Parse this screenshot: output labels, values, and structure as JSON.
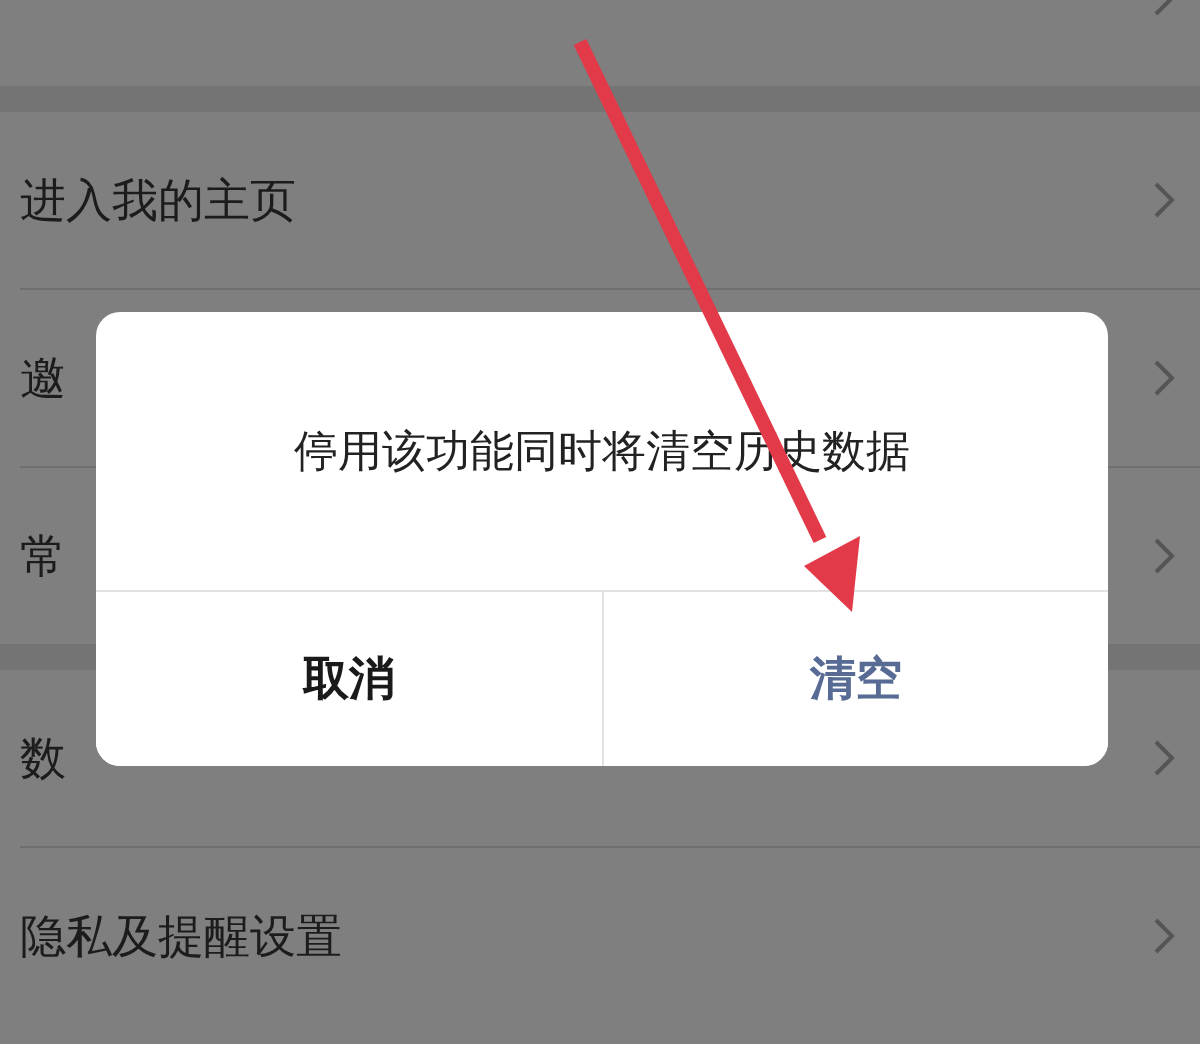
{
  "groups": [
    {
      "items": [
        {
          "label": "进入我的主页"
        },
        {
          "label": "邀"
        },
        {
          "label": "常"
        }
      ]
    },
    {
      "items": [
        {
          "label": "数"
        },
        {
          "label": "隐私及提醒设置"
        }
      ]
    }
  ],
  "dialog": {
    "message": "停用该功能同时将清空历史数据",
    "buttons": [
      {
        "label": "取消",
        "kind": "cancel"
      },
      {
        "label": "清空",
        "kind": "confirm"
      }
    ]
  }
}
